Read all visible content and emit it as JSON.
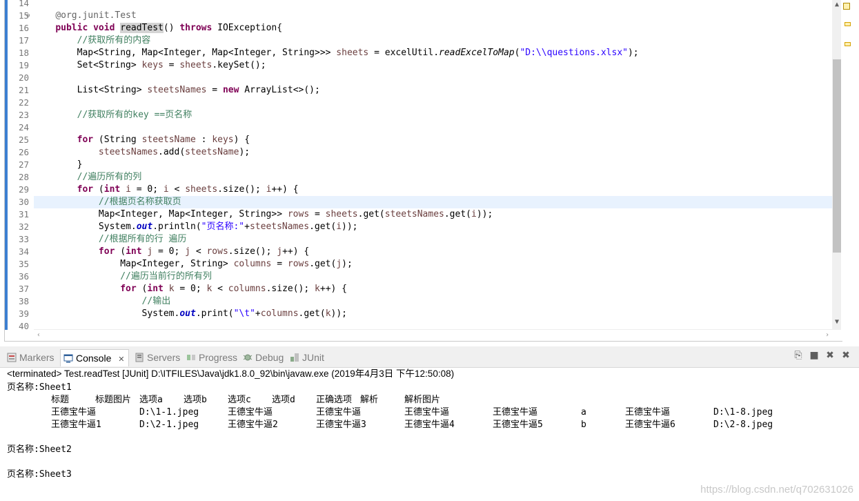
{
  "editor": {
    "lines": [
      {
        "n": "14",
        "tokens": []
      },
      {
        "n": "15",
        "fold": "⊖",
        "tokens": [
          [
            "    ",
            ""
          ],
          [
            "@org.junit.Test",
            "an"
          ]
        ]
      },
      {
        "n": "16",
        "tokens": [
          [
            "    ",
            ""
          ],
          [
            "public",
            "kw"
          ],
          [
            " ",
            ""
          ],
          [
            "void",
            "kw"
          ],
          [
            " ",
            ""
          ],
          [
            "readTest",
            "hl"
          ],
          [
            "() ",
            ""
          ],
          [
            "throws",
            "kw"
          ],
          [
            " IOException{",
            ""
          ]
        ]
      },
      {
        "n": "17",
        "tokens": [
          [
            "        ",
            ""
          ],
          [
            "//获取所有的内容",
            "cm"
          ]
        ]
      },
      {
        "n": "18",
        "tokens": [
          [
            "        Map<String, Map<Integer, Map<Integer, String>>> ",
            ""
          ],
          [
            "sheets",
            "lv"
          ],
          [
            " = ",
            ""
          ],
          [
            "excelUtil",
            ""
          ],
          [
            ".",
            ""
          ],
          [
            "readExcelToMap",
            "it"
          ],
          [
            "(",
            ""
          ],
          [
            "\"D:\\\\questions.xlsx\"",
            "st"
          ],
          [
            ");",
            ""
          ]
        ]
      },
      {
        "n": "19",
        "tokens": [
          [
            "        Set<String> ",
            ""
          ],
          [
            "keys",
            "lv"
          ],
          [
            " = ",
            ""
          ],
          [
            "sheets",
            "lv"
          ],
          [
            ".keySet();",
            ""
          ]
        ]
      },
      {
        "n": "20",
        "tokens": []
      },
      {
        "n": "21",
        "tokens": [
          [
            "        List<String> ",
            ""
          ],
          [
            "steetsNames",
            "lv"
          ],
          [
            " = ",
            ""
          ],
          [
            "new",
            "kw"
          ],
          [
            " ArrayList<>();",
            ""
          ]
        ]
      },
      {
        "n": "22",
        "tokens": []
      },
      {
        "n": "23",
        "tokens": [
          [
            "        ",
            ""
          ],
          [
            "//获取所有的key ==页名称",
            "cm"
          ]
        ]
      },
      {
        "n": "24",
        "tokens": []
      },
      {
        "n": "25",
        "tokens": [
          [
            "        ",
            ""
          ],
          [
            "for",
            "kw"
          ],
          [
            " (String ",
            ""
          ],
          [
            "steetsName",
            "lv"
          ],
          [
            " : ",
            ""
          ],
          [
            "keys",
            "lv"
          ],
          [
            ") {",
            ""
          ]
        ]
      },
      {
        "n": "26",
        "tokens": [
          [
            "            ",
            ""
          ],
          [
            "steetsNames",
            "lv"
          ],
          [
            ".add(",
            ""
          ],
          [
            "steetsName",
            "lv"
          ],
          [
            ");",
            ""
          ]
        ]
      },
      {
        "n": "27",
        "tokens": [
          [
            "        }",
            ""
          ]
        ]
      },
      {
        "n": "28",
        "tokens": [
          [
            "        ",
            ""
          ],
          [
            "//遍历所有的列",
            "cm"
          ]
        ]
      },
      {
        "n": "29",
        "tokens": [
          [
            "        ",
            ""
          ],
          [
            "for",
            "kw"
          ],
          [
            " (",
            ""
          ],
          [
            "int",
            "kw"
          ],
          [
            " ",
            ""
          ],
          [
            "i",
            "lv"
          ],
          [
            " = 0; ",
            ""
          ],
          [
            "i",
            "lv"
          ],
          [
            " < ",
            ""
          ],
          [
            "sheets",
            "lv"
          ],
          [
            ".size(); ",
            ""
          ],
          [
            "i",
            "lv"
          ],
          [
            "++) {",
            ""
          ]
        ]
      },
      {
        "n": "30",
        "cur": true,
        "tokens": [
          [
            "            ",
            ""
          ],
          [
            "//根据页名称获取页",
            "cm"
          ]
        ]
      },
      {
        "n": "31",
        "tokens": [
          [
            "            Map<Integer, Map<Integer, String>> ",
            ""
          ],
          [
            "rows",
            "lv"
          ],
          [
            " = ",
            ""
          ],
          [
            "sheets",
            "lv"
          ],
          [
            ".get(",
            ""
          ],
          [
            "steetsNames",
            "lv"
          ],
          [
            ".get(",
            ""
          ],
          [
            "i",
            "lv"
          ],
          [
            "));",
            ""
          ]
        ]
      },
      {
        "n": "32",
        "tokens": [
          [
            "            System.",
            ""
          ],
          [
            "out",
            "sf"
          ],
          [
            ".println(",
            ""
          ],
          [
            "\"页名称:\"",
            "st"
          ],
          [
            "+",
            ""
          ],
          [
            "steetsNames",
            "lv"
          ],
          [
            ".get(",
            ""
          ],
          [
            "i",
            "lv"
          ],
          [
            "));",
            ""
          ]
        ]
      },
      {
        "n": "33",
        "tokens": [
          [
            "            ",
            ""
          ],
          [
            "//根据所有的行 遍历",
            "cm"
          ]
        ]
      },
      {
        "n": "34",
        "tokens": [
          [
            "            ",
            ""
          ],
          [
            "for",
            "kw"
          ],
          [
            " (",
            ""
          ],
          [
            "int",
            "kw"
          ],
          [
            " ",
            ""
          ],
          [
            "j",
            "lv"
          ],
          [
            " = 0; ",
            ""
          ],
          [
            "j",
            "lv"
          ],
          [
            " < ",
            ""
          ],
          [
            "rows",
            "lv"
          ],
          [
            ".size(); ",
            ""
          ],
          [
            "j",
            "lv"
          ],
          [
            "++) {",
            ""
          ]
        ]
      },
      {
        "n": "35",
        "tokens": [
          [
            "                Map<Integer, String> ",
            ""
          ],
          [
            "columns",
            "lv"
          ],
          [
            " = ",
            ""
          ],
          [
            "rows",
            "lv"
          ],
          [
            ".get(",
            ""
          ],
          [
            "j",
            "lv"
          ],
          [
            ");",
            ""
          ]
        ]
      },
      {
        "n": "36",
        "tokens": [
          [
            "                ",
            ""
          ],
          [
            "//遍历当前行的所有列",
            "cm"
          ]
        ]
      },
      {
        "n": "37",
        "tokens": [
          [
            "                ",
            ""
          ],
          [
            "for",
            "kw"
          ],
          [
            " (",
            ""
          ],
          [
            "int",
            "kw"
          ],
          [
            " ",
            ""
          ],
          [
            "k",
            "lv"
          ],
          [
            " = 0; ",
            ""
          ],
          [
            "k",
            "lv"
          ],
          [
            " < ",
            ""
          ],
          [
            "columns",
            "lv"
          ],
          [
            ".size(); ",
            ""
          ],
          [
            "k",
            "lv"
          ],
          [
            "++) {",
            ""
          ]
        ]
      },
      {
        "n": "38",
        "tokens": [
          [
            "                    ",
            ""
          ],
          [
            "//输出",
            "cm"
          ]
        ]
      },
      {
        "n": "39",
        "tokens": [
          [
            "                    System.",
            ""
          ],
          [
            "out",
            "sf"
          ],
          [
            ".print(",
            ""
          ],
          [
            "\"\\t\"",
            "st"
          ],
          [
            "+",
            ""
          ],
          [
            "columns",
            "lv"
          ],
          [
            ".get(",
            ""
          ],
          [
            "k",
            "lv"
          ],
          [
            "));",
            ""
          ]
        ]
      },
      {
        "n": "40",
        "tokens": []
      }
    ]
  },
  "tabs": [
    {
      "id": "markers",
      "label": "Markers",
      "active": false,
      "icon": "markers-icon"
    },
    {
      "id": "console",
      "label": "Console",
      "active": true,
      "icon": "console-icon",
      "close": "✕"
    },
    {
      "id": "servers",
      "label": "Servers",
      "active": false,
      "icon": "servers-icon"
    },
    {
      "id": "progress",
      "label": "Progress",
      "active": false,
      "icon": "progress-icon"
    },
    {
      "id": "debug",
      "label": "Debug",
      "active": false,
      "icon": "debug-icon"
    },
    {
      "id": "junit",
      "label": "JUnit",
      "active": false,
      "icon": "junit-icon"
    }
  ],
  "console": {
    "terminated": "<terminated> Test.readTest [JUnit] D:\\ITFILES\\Java\\jdk1.8.0_92\\bin\\javaw.exe (2019年4月3日 下午12:50:08)",
    "sheet1": "页名称:Sheet1",
    "header": [
      "标题",
      "标题图片",
      "选项a",
      "选项b",
      "选项c",
      "选项d",
      "正确选项",
      "解析",
      "解析图片"
    ],
    "rows": [
      [
        "王德宝牛逼",
        "D:\\1-1.jpeg",
        "王德宝牛逼",
        "王德宝牛逼",
        "王德宝牛逼",
        "王德宝牛逼",
        "a",
        "王德宝牛逼",
        "D:\\1-8.jpeg"
      ],
      [
        "王德宝牛逼1",
        "D:\\2-1.jpeg",
        "王德宝牛逼2",
        "王德宝牛逼3",
        "王德宝牛逼4",
        "王德宝牛逼5",
        "b",
        "王德宝牛逼6",
        "D:\\2-8.jpeg"
      ]
    ],
    "sheet2": "页名称:Sheet2",
    "sheet3": "页名称:Sheet3"
  },
  "watermark": "https://blog.csdn.net/q702631026"
}
